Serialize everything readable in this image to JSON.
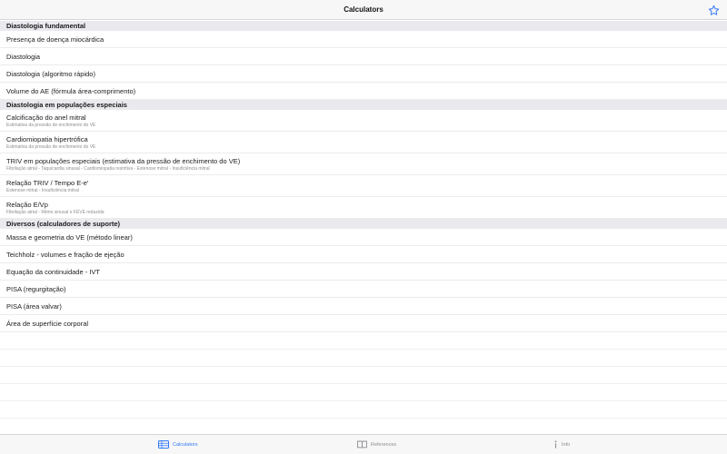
{
  "app": {
    "title": "Calculators",
    "accent": "#3478f6"
  },
  "sections": [
    {
      "header": "Diastologia fundamental",
      "items": [
        {
          "title": "Presença de doença miocárdica"
        },
        {
          "title": "Diastologia"
        },
        {
          "title": "Diastologia (algoritmo rápido)"
        },
        {
          "title": "Volume do AE (fórmula área-comprimento)"
        }
      ]
    },
    {
      "header": "Diastologia em populações especiais",
      "items": [
        {
          "title": "Calcificação do anel mitral",
          "subtitle": "Estimativa da pressão de enchimento do VE"
        },
        {
          "title": "Cardiomiopatia hipertrófica",
          "subtitle": "Estimativa da pressão de enchimento do VE"
        },
        {
          "title": "TRIV em populações especiais (estimativa da pressão de enchimento do VE)",
          "subtitle": "Fibrilação atrial - Taquicardia sinusal - Cardiomiopatia restritiva - Estenose mitral - Insuficiência mitral"
        },
        {
          "title": "Relação TRIV / Tempo E-e'",
          "subtitle": "Estenose mitral - Insuficiência mitral"
        },
        {
          "title": "Relação E/Vp",
          "subtitle": "Fibrilação atrial - Ritmo sinusal e FEVE reduzida"
        }
      ]
    },
    {
      "header": "Diversos (calculadores de suporte)",
      "items": [
        {
          "title": "Massa e geometria do VE (método linear)"
        },
        {
          "title": "Teichholz - volumes e fração de ejeção"
        },
        {
          "title": "Equação da continuidade - IVT"
        },
        {
          "title": "PISA (regurgitação)"
        },
        {
          "title": "PISA (área valvar)"
        },
        {
          "title": "Área de superfície corporal"
        }
      ]
    }
  ],
  "tabs": [
    {
      "label": "Calculators",
      "icon": "table-icon",
      "active": true
    },
    {
      "label": "References",
      "icon": "book-icon",
      "active": false
    },
    {
      "label": "Info",
      "icon": "info-icon",
      "active": false
    }
  ]
}
